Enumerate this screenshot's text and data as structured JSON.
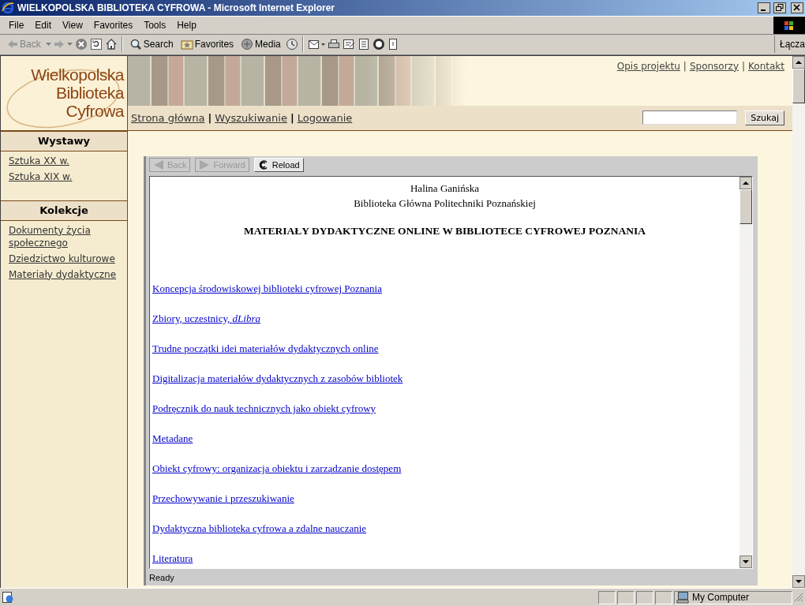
{
  "window": {
    "title": "WIELKOPOLSKA BIBLIOTEKA CYFROWA - Microsoft Internet Explorer"
  },
  "menu": [
    "File",
    "Edit",
    "View",
    "Favorites",
    "Tools",
    "Help"
  ],
  "toolbar": {
    "back": {
      "label": "Back",
      "disabled": true
    },
    "search": "Search",
    "favorites": "Favorites",
    "media": "Media",
    "links": "Łącza"
  },
  "site": {
    "logo": [
      "Wielkopolska",
      "Biblioteka",
      "Cyfrowa"
    ],
    "top_links": [
      "Opis projektu",
      "Sponsorzy",
      "Kontakt"
    ],
    "top_separator": "|",
    "nav": [
      "Strona główna",
      "Wyszukiwanie",
      "Logowanie"
    ],
    "nav_separator": "|",
    "search": {
      "button": "Szukaj"
    },
    "sidebar": [
      {
        "heading": "Wystawy",
        "items": [
          "Sztuka XX w.",
          "Sztuka XIX w."
        ]
      },
      {
        "heading": "Kolekcje",
        "items": [
          "Dokumenty życia społecznego",
          "Dziedzictwo kulturowe",
          "Materiały dydaktyczne"
        ]
      }
    ],
    "applet": {
      "buttons": [
        {
          "kind": "back",
          "label": "Back",
          "disabled": true
        },
        {
          "kind": "forward",
          "label": "Forward",
          "disabled": true
        },
        {
          "kind": "reload",
          "label": "Reload",
          "disabled": false
        }
      ],
      "author": "Halina Ganińska",
      "affiliation": "Biblioteka Główna Politechniki Poznańskiej",
      "heading": "MATERIAŁY DYDAKTYCZNE ONLINE W BIBLIOTECE CYFROWEJ POZNANIA",
      "links": [
        "Koncepcja środowiskowej biblioteki cyfrowej Poznania",
        "Zbiory, uczestnicy, *dLibra*",
        "Trudne początki idei materiałów dydaktycznych online",
        "Digitalizacja materiałów dydaktycznych z zasobów bibliotek",
        "Podręcznik do nauk technicznych jako obiekt cyfrowy",
        "Metadane",
        "Obiekt cyfrowy: organizacja obiektu i zarządzanie dostępem",
        "Przechowywanie i przeszukiwanie",
        "Dydaktyczna biblioteka cyfrowa a zdalne nauczanie",
        "Literatura"
      ],
      "status": "Ready"
    }
  },
  "status_bar": {
    "zone": "My Computer"
  }
}
